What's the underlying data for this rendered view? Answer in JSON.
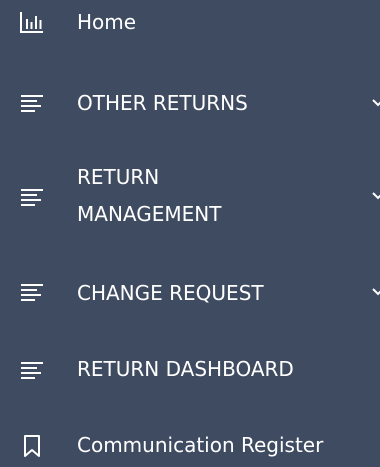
{
  "colors": {
    "background": "#3f4b60",
    "text": "#ffffff"
  },
  "menu": {
    "items": [
      {
        "label": "Home",
        "icon": "bar-chart-icon",
        "has_submenu": false
      },
      {
        "label": "OTHER RETURNS",
        "icon": "lines-icon",
        "has_submenu": true
      },
      {
        "label": "RETURN MANAGEMENT",
        "icon": "lines-icon",
        "has_submenu": true
      },
      {
        "label": "CHANGE REQUEST",
        "icon": "lines-icon",
        "has_submenu": true
      },
      {
        "label": "RETURN DASHBOARD",
        "icon": "lines-icon",
        "has_submenu": false
      },
      {
        "label": "Communication Register",
        "icon": "bookmark-icon",
        "has_submenu": false
      }
    ]
  }
}
